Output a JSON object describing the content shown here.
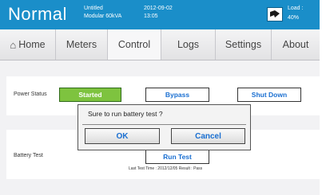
{
  "header": {
    "mode": "Normal",
    "device_line1": "Untitled",
    "device_line2": "Modular 60kVA",
    "date": "2012-09-02",
    "time": "13:05",
    "load_label": "Load :",
    "load_value": "40%"
  },
  "tabs": [
    {
      "label": "Home",
      "icon": "home-icon"
    },
    {
      "label": "Meters"
    },
    {
      "label": "Control"
    },
    {
      "label": "Logs"
    },
    {
      "label": "Settings"
    },
    {
      "label": "About"
    }
  ],
  "power_status": {
    "label": "Power Status",
    "started_label": "Started",
    "bypass_label": "Bypass",
    "shutdown_label": "Shut Down"
  },
  "battery_test": {
    "label": "Battery Test",
    "run_label": "Run Test",
    "last_test": "Last Test Time : 2012/12/05    Result : Pass"
  },
  "dialog": {
    "message": "Sure to run battery test ?",
    "ok_label": "OK",
    "cancel_label": "Cancel"
  },
  "colors": {
    "header_bg": "#1a8ec9",
    "started_green": "#7ec33f",
    "button_text": "#1a6fd1"
  }
}
